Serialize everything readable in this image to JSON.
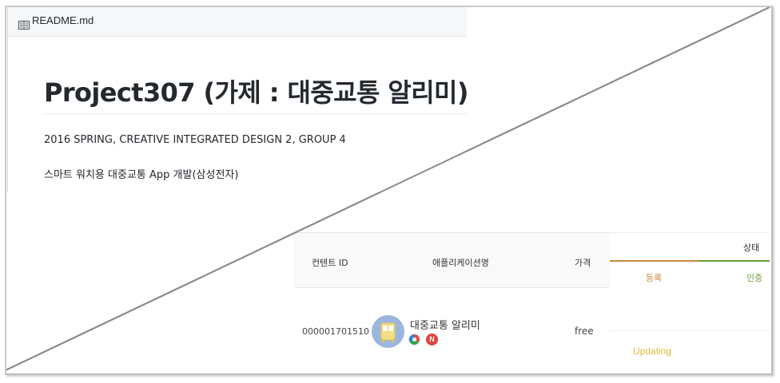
{
  "readme": {
    "filename": "README.md",
    "title": "Project307 (가제 : 대중교통 알리미)",
    "subtitle": "2016 SPRING, CREATIVE INTEGRATED DESIGN 2, GROUP 4",
    "description": "스마트 워치용 대중교통 App 개발(삼성전자)"
  },
  "table": {
    "headers": {
      "content_id": "컨텐트 ID",
      "app_name": "애플리케이션명",
      "price": "가격",
      "status": "상태"
    },
    "status_steps": [
      "등록",
      "인증"
    ],
    "rows": [
      {
        "content_id": "000001701510",
        "app_name": "대중교통 알리미",
        "price": "free",
        "status": "Updating"
      }
    ]
  },
  "colors": {
    "status_orange": "#c98a3d",
    "status_green": "#6b9a3a",
    "updating": "#e2b93b",
    "app_icon_bg": "#9db6dd"
  },
  "icons": {
    "readme": "book-icon",
    "app": "bus-icon",
    "badge_1": "gear-color-icon",
    "badge_2": "n-badge-icon"
  }
}
